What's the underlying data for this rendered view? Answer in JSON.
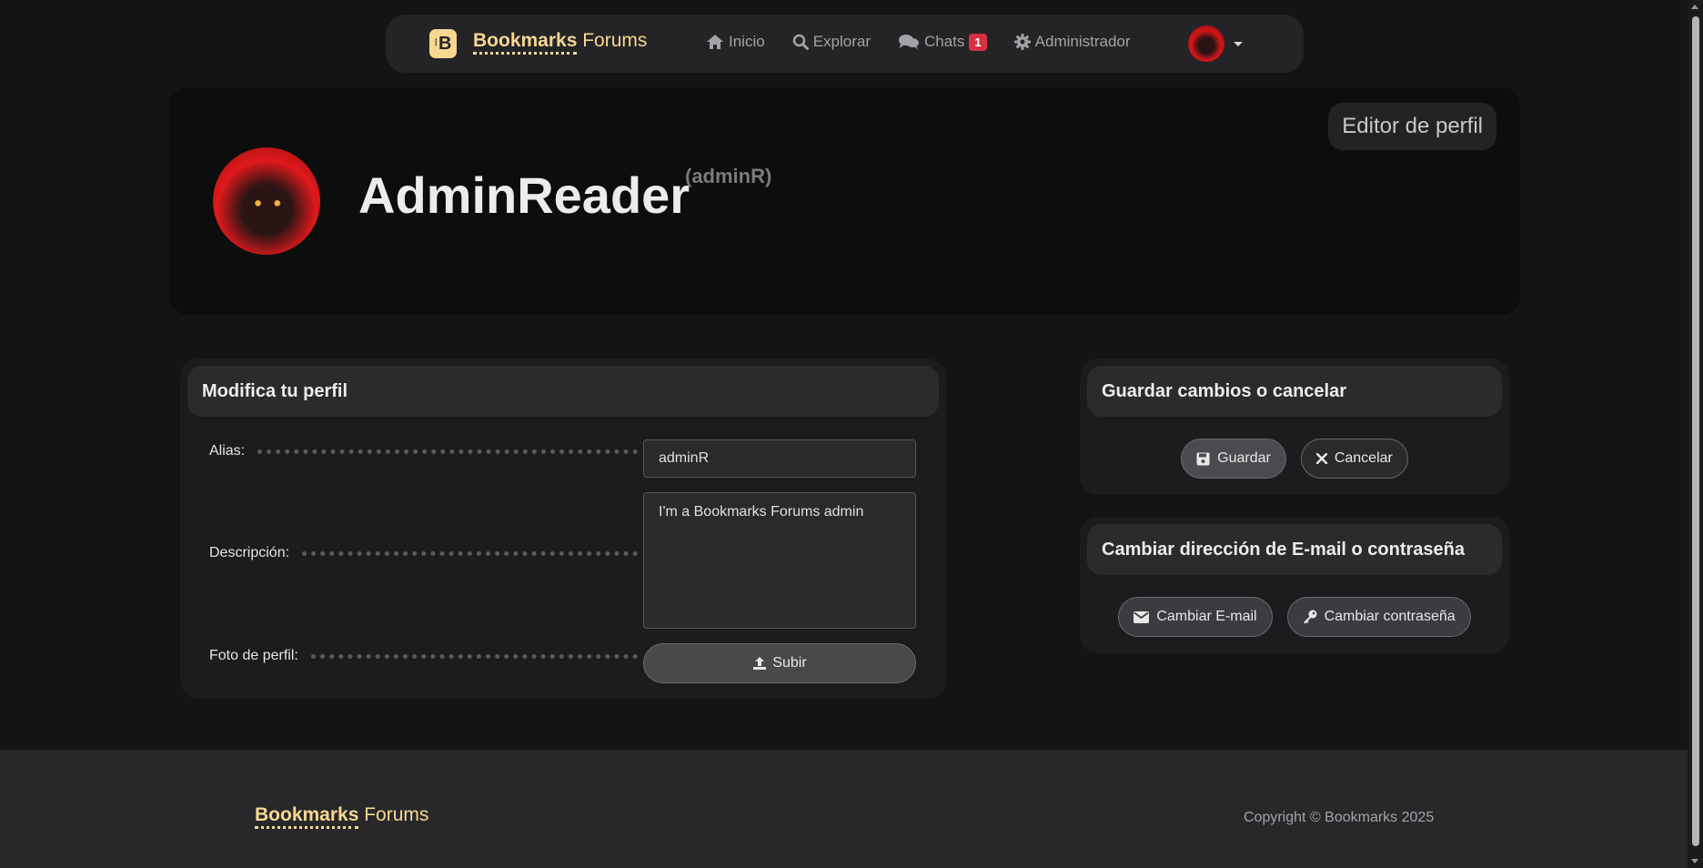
{
  "nav": {
    "brand_bold": "Bookmarks",
    "brand_light": "Forums",
    "brand_logo": "B",
    "links": [
      {
        "label": "Inicio",
        "icon": "home-icon"
      },
      {
        "label": "Explorar",
        "icon": "search-icon"
      },
      {
        "label": "Chats",
        "icon": "chats-icon",
        "badge": "1"
      },
      {
        "label": "Administrador",
        "icon": "gear-icon"
      }
    ]
  },
  "profile": {
    "name": "AdminReader",
    "alias": "(adminR)",
    "editor_label": "Editor de perfil"
  },
  "edit_card": {
    "title": "Modifica tu perfil",
    "alias_label": "Alias:",
    "alias_value": "adminR",
    "description_label": "Descripción:",
    "description_value": "I'm a Bookmarks Forums admin",
    "photo_label": "Foto de perfil:",
    "upload_label": "Subir"
  },
  "save_card": {
    "title": "Guardar cambios o cancelar",
    "save_label": "Guardar",
    "cancel_label": "Cancelar"
  },
  "email_card": {
    "title": "Cambiar dirección de E-mail o contraseña",
    "email_label": "Cambiar E-mail",
    "password_label": "Cambiar contraseña"
  },
  "footer": {
    "brand_bold": "Bookmarks",
    "brand_light": "Forums",
    "copyright": "Copyright © Bookmarks 2025"
  },
  "colors": {
    "accent": "#f7d790",
    "badge": "#d63143",
    "background": "#141414"
  }
}
